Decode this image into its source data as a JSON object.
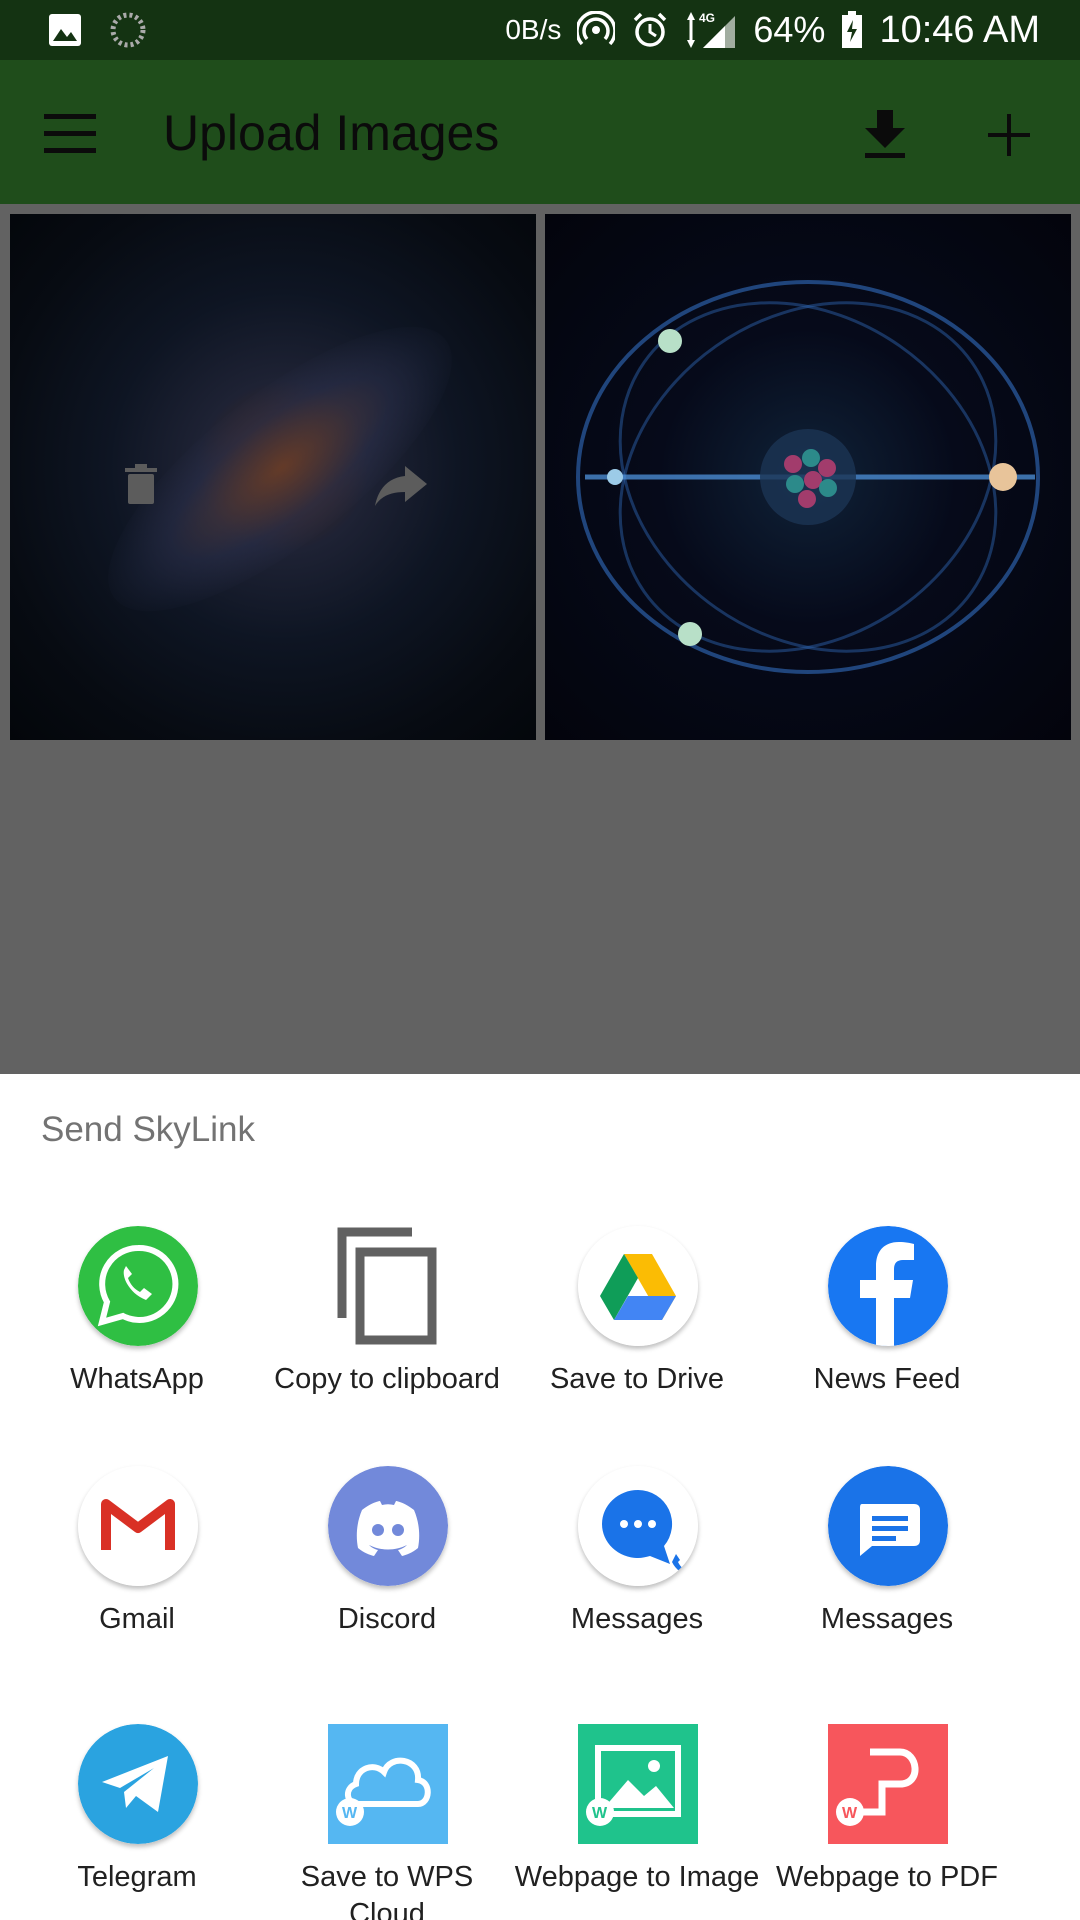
{
  "status_bar": {
    "speed": "0B/s",
    "battery": "64%",
    "time": "10:46 AM",
    "icons": [
      "image-icon",
      "loading-icon",
      "hotspot-icon",
      "alarm-icon",
      "signal-4g-icon",
      "battery-icon"
    ]
  },
  "appbar": {
    "title": "Upload Images",
    "icons": [
      "menu-icon",
      "download-icon",
      "add-icon"
    ]
  },
  "thumbnails": [
    {
      "name": "galaxy-image",
      "overlay_icons": [
        "trash-icon",
        "share-icon"
      ]
    },
    {
      "name": "atom-image"
    }
  ],
  "share_sheet": {
    "title": "Send SkyLink",
    "apps": [
      {
        "label": "WhatsApp",
        "icon": "whatsapp-icon",
        "color": "#2fbf43"
      },
      {
        "label": "Copy to clipboard",
        "icon": "copy-icon",
        "color": "#616161"
      },
      {
        "label": "Save to Drive",
        "icon": "google-drive-icon",
        "color": "#ffffff"
      },
      {
        "label": "News Feed",
        "icon": "facebook-icon",
        "color": "#1877f2"
      },
      {
        "label": "Gmail",
        "icon": "gmail-icon",
        "color": "#ffffff"
      },
      {
        "label": "Discord",
        "icon": "discord-icon",
        "color": "#7289da"
      },
      {
        "label": "Messages",
        "icon": "messages-icon",
        "color": "#ffffff"
      },
      {
        "label": "Messages",
        "icon": "messages-blue-icon",
        "color": "#1a73e8"
      },
      {
        "label": "Telegram",
        "icon": "telegram-icon",
        "color": "#2aa3e0"
      },
      {
        "label": "Save to WPS Cloud",
        "icon": "wps-cloud-icon",
        "color": "#55b7f2"
      },
      {
        "label": "Webpage to Image",
        "icon": "webpage-image-icon",
        "color": "#1fc38c"
      },
      {
        "label": "Webpage to PDF",
        "icon": "webpage-pdf-icon",
        "color": "#f7565c"
      }
    ]
  },
  "colors": {
    "status_bar": "#143312",
    "app_bar": "#1f4d1b",
    "scrim": "#626262",
    "sheet": "#ffffff"
  }
}
